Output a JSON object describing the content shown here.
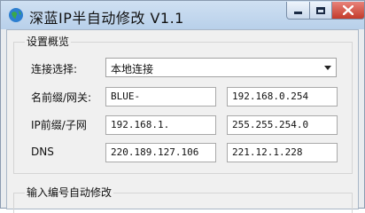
{
  "window": {
    "title": "深蓝IP半自动修改 V1.1"
  },
  "colors": {
    "titlebar": "#b8d0ea",
    "close_button": "#c43b2b",
    "background": "#f0f0f0"
  },
  "overview": {
    "group_title": "设置概览",
    "connection_label": "连接选择:",
    "connection_value": "本地连接",
    "name_gateway_label": "名前缀/网关:",
    "name_prefix": "BLUE-",
    "gateway": "192.168.0.254",
    "ip_mask_label": "IP前缀/子网",
    "ip_prefix": "192.168.1.",
    "subnet_mask": "255.255.254.0",
    "dns_label": "DNS",
    "dns_primary": "220.189.127.106",
    "dns_secondary": "221.12.1.228"
  },
  "auto_modify": {
    "group_title": "输入编号自动修改"
  },
  "icons": {
    "app": "globe-icon",
    "minimize": "minimize-icon",
    "maximize": "maximize-icon",
    "close": "close-icon",
    "dropdown": "chevron-down-icon"
  }
}
